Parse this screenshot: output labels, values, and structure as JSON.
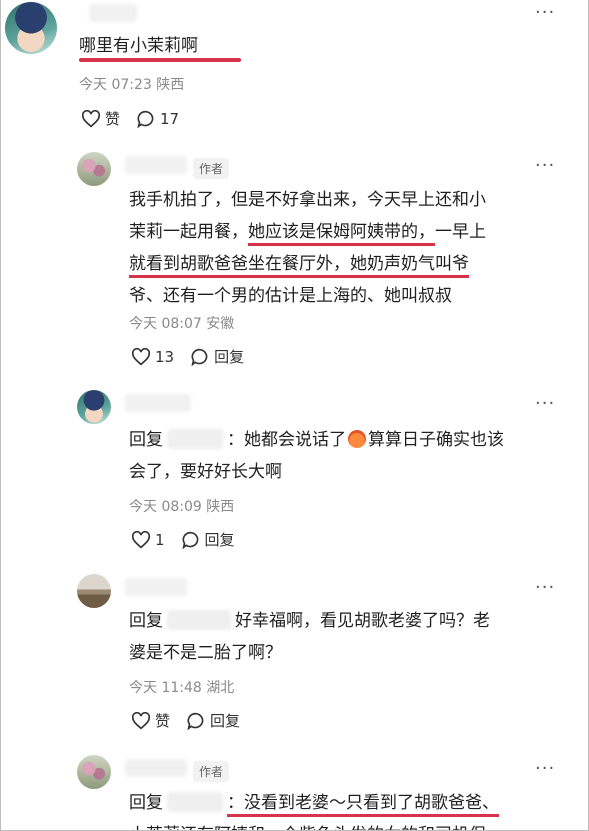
{
  "comments": [
    {
      "text": "哪里有小茉莉啊",
      "meta": "今天 07:23 陕西",
      "like_label": "赞",
      "reply_count": "17"
    },
    {
      "author_tag": "作者",
      "text_line1": "我手机拍了，但是不好拿出来，今天早上还和小",
      "text_line2a": "茉莉一起用餐，",
      "text_line2b": "她应该是保姆阿姨带的，",
      "text_line2c": "一早上",
      "text_line3a": "就看到胡歌爸爸坐在餐厅外，她奶声奶气叫爷",
      "text_line4": "爷、还有一个男的估计是上海的、她叫叔叔",
      "meta": "今天 08:07 安徽",
      "like_count": "13",
      "reply_label": "回复"
    },
    {
      "reply_prefix": "回复",
      "text_a": "：她都会说话了",
      "text_b": "算算日子确实也该",
      "text_line2": "会了，要好好长大啊",
      "meta": "今天 08:09 陕西",
      "like_count": "1",
      "reply_label": "回复"
    },
    {
      "reply_prefix": "回复",
      "text_a": "好幸福啊，看见胡歌老婆了吗？老",
      "text_line2": "婆是不是二胎了啊？",
      "meta": "今天 11:48 湖北",
      "like_label": "赞",
      "reply_label": "回复"
    },
    {
      "author_tag": "作者",
      "reply_prefix": "回复",
      "text_a": "：没看到老婆～只看到了胡歌爸爸、",
      "text_line2": "小茉莉还有阿姨和一个紫色头发的女的和司机保"
    }
  ],
  "icons": {
    "more": "more-horizontal-icon",
    "like": "heart-icon",
    "comment": "comment-bubble-icon",
    "emoji": "red-face-emoji-icon"
  },
  "colors": {
    "highlight_underline": "#d8334a",
    "meta_gray": "#8a8a8a"
  }
}
